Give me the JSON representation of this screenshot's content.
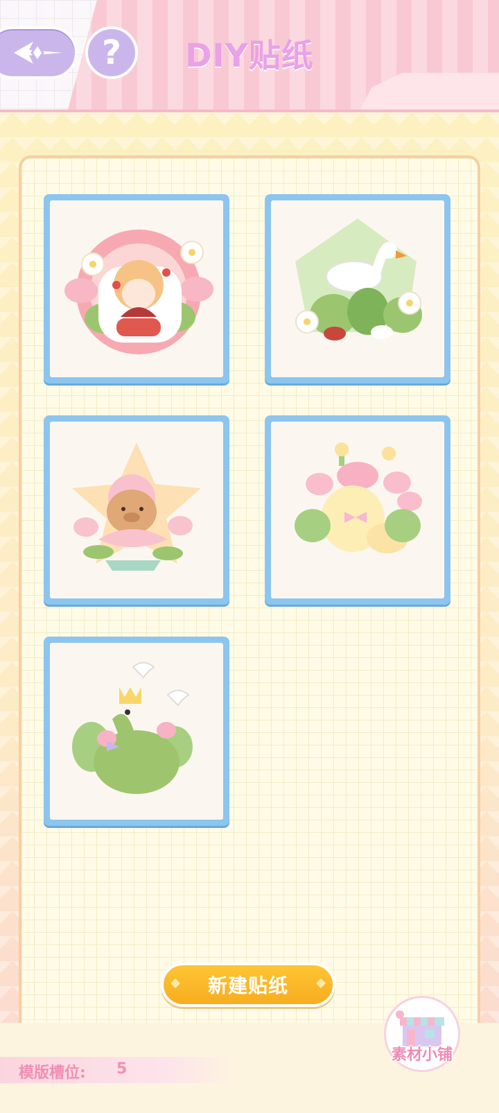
{
  "header": {
    "title": "DIY贴纸",
    "help_label": "?"
  },
  "templates": [
    {
      "name": "girl-with-fan-sticker"
    },
    {
      "name": "goose-garden-sticker"
    },
    {
      "name": "capybara-lotus-sticker"
    },
    {
      "name": "chick-tulip-sticker"
    },
    {
      "name": "frog-crown-sticker"
    }
  ],
  "actions": {
    "new_sticker_label": "新建贴纸",
    "shop_label": "素材小铺"
  },
  "footer": {
    "slot_label": "模版槽位:",
    "slot_value": "5"
  },
  "colors": {
    "accent_purple": "#cbb6ec",
    "title_pink": "#e9a1e8",
    "card_blue": "#8cc5ef",
    "button_yellow": "#fdc534"
  }
}
